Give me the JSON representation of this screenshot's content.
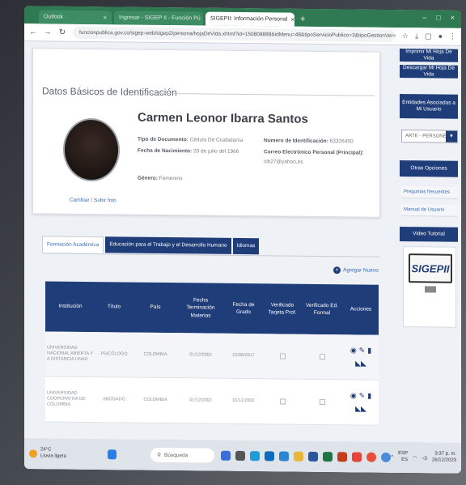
{
  "browser": {
    "tabs": [
      {
        "label": "Outlook"
      },
      {
        "label": "Ingresar - SIGEP II - Función Pú"
      },
      {
        "label": "SIGEPII: Información Personal"
      }
    ],
    "url": "funcionpublica.gov.co/sigep-web/sigep2/persona/hojaDeVida.xhtml?id=150809888&idMenu=48&tipoServicioPublico=3&tipoGestionVer=Consulta+Otro+ent...",
    "colors": {
      "chrome": "#2f7a52",
      "primary": "#1f3d78",
      "link": "#3b6cb3"
    }
  },
  "profile": {
    "section_title": "Datos Básicos de Identificación",
    "name": "Carmen Leonor Ibarra Santos",
    "doc_type_label": "Tipo de Documento:",
    "doc_type_value": "Cédula De Ciudadanía",
    "birth_label": "Fecha de Nacimiento:",
    "birth_value": "20 de julio del 1966",
    "gender_label": "Género:",
    "gender_value": "Femenino",
    "id_label": "Número de Identificación:",
    "id_value": "63326450",
    "email_label": "Correo Electrónico Personal (Principal):",
    "email_value": "cib27@yahoo.es",
    "change_photo": "Cambiar / Subir foto"
  },
  "side": {
    "print_cv": "Imprimir Mi Hoja De Vida",
    "download_cv": "Descargar Mi Hoja De Vida",
    "entities_title": "Entidades Asociadas a Mi Usuario",
    "entity_select": "ARTE - PERSONERÍ",
    "other_options": "Otras Opciones",
    "faq": "Preguntas frecuentes",
    "manual": "Manual de Usuario",
    "video": "Video Tutorial",
    "logo_text": "SIGEPII"
  },
  "tabs": [
    {
      "label": "Formación Académica"
    },
    {
      "label": "Educación para el Trabajo y el Desarrollo Humano"
    },
    {
      "label": "Idiomas"
    }
  ],
  "add_new": "Agregar Nuevo",
  "table": {
    "headers": [
      "Institución",
      "Título",
      "País",
      "Fecha Terminación Materias",
      "Fecha de Grado",
      "Verificado Tarjeta Prof.",
      "Verificado Ed. Formal",
      "Acciones"
    ],
    "rows": [
      {
        "institution": "UNIVERSIDAD NACIONAL ABIERTA Y A DISTANCIA UNAD",
        "title": "PSICÓLOGO",
        "country": "COLOMBIA",
        "end_date": "01/12/2002",
        "grad_date": "22/08/2017"
      },
      {
        "institution": "UNIVERSIDAD COOPERATIVA DE COLOMBIA",
        "title": "ABOGADO",
        "country": "COLOMBIA",
        "end_date": "01/12/2002",
        "grad_date": "01/11/2002"
      }
    ]
  },
  "taskbar": {
    "temp": "24°C",
    "weather": "Lluvia ligera",
    "search": "Búsqueda",
    "lang": "ESP",
    "lang2": "ES",
    "time": "3:37 p. m.",
    "date": "26/12/2023"
  }
}
